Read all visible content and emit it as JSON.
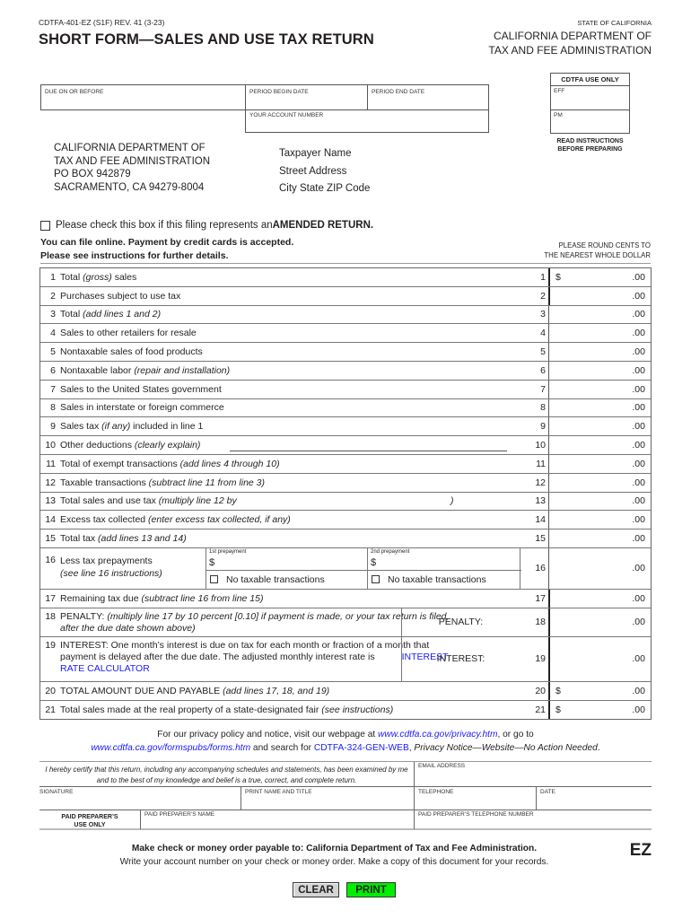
{
  "header": {
    "form_id": "CDTFA-401-EZ (S1F) REV. 41 (3-23)",
    "title": "SHORT FORM—SALES AND USE TAX RETURN",
    "state": "STATE OF CALIFORNIA",
    "agency_line1": "CALIFORNIA DEPARTMENT OF",
    "agency_line2": "TAX AND FEE ADMINISTRATION"
  },
  "fields": {
    "due_on_or_before": "DUE ON OR BEFORE",
    "period_begin": "PERIOD BEGIN DATE",
    "period_end": "PERIOD END DATE",
    "account_number": "YOUR ACCOUNT NUMBER"
  },
  "use_only": {
    "title": "CDTFA USE ONLY",
    "eff": "EFF",
    "pm": "PM",
    "read_line1": "READ INSTRUCTIONS",
    "read_line2": "BEFORE PREPARING"
  },
  "mailing": [
    "CALIFORNIA DEPARTMENT OF",
    "TAX AND FEE ADMINISTRATION",
    "PO BOX 942879",
    "SACRAMENTO, CA 94279-8004"
  ],
  "taxpayer": [
    "Taxpayer Name",
    "Street Address",
    "City State ZIP Code"
  ],
  "amended": {
    "prefix": "Please check this box if this filing represents an ",
    "bold": "AMENDED RETURN",
    "suffix": ".",
    "checked": false
  },
  "online_note": [
    "You can file online. Payment by credit cards is accepted.",
    "Please see instructions for further details."
  ],
  "round_note": [
    "PLEASE ROUND CENTS TO",
    "THE NEAREST WHOLE DOLLAR"
  ],
  "lines": [
    {
      "n": "1",
      "text": "Total ",
      "em": "(gross)",
      "after": " sales",
      "dollar": "$",
      "amount": ".00"
    },
    {
      "n": "2",
      "text": "Purchases subject to use tax",
      "em": "",
      "after": "",
      "dollar": "",
      "amount": ".00"
    },
    {
      "n": "3",
      "text": "Total ",
      "em": "(add lines 1 and 2)",
      "after": "",
      "dollar": "",
      "amount": ".00"
    },
    {
      "n": "4",
      "text": "Sales to other retailers for resale",
      "em": "",
      "after": "",
      "dollar": "",
      "amount": ".00"
    },
    {
      "n": "5",
      "text": "Nontaxable sales of food products",
      "em": "",
      "after": "",
      "dollar": "",
      "amount": ".00"
    },
    {
      "n": "6",
      "text": "Nontaxable labor ",
      "em": "(repair and installation)",
      "after": "",
      "dollar": "",
      "amount": ".00"
    },
    {
      "n": "7",
      "text": "Sales to the United States government",
      "em": "",
      "after": "",
      "dollar": "",
      "amount": ".00"
    },
    {
      "n": "8",
      "text": "Sales in interstate or foreign commerce",
      "em": "",
      "after": "",
      "dollar": "",
      "amount": ".00"
    },
    {
      "n": "9",
      "text": "Sales tax ",
      "em": "(if any)",
      "after": " included in line 1",
      "dollar": "",
      "amount": ".00"
    },
    {
      "n": "10",
      "text": "Other deductions ",
      "em": "(clearly explain)",
      "after": "",
      "dollar": "",
      "amount": ".00"
    },
    {
      "n": "11",
      "text": "Total of exempt transactions ",
      "em": "(add lines 4 through 10)",
      "after": "",
      "dollar": "",
      "amount": ".00"
    },
    {
      "n": "12",
      "text": "Taxable transactions ",
      "em": "(subtract line 11 from line 3)",
      "after": "",
      "dollar": "",
      "amount": ".00"
    },
    {
      "n": "13",
      "text": "Total sales and use tax ",
      "em": "(multiply line 12 by",
      "after": "",
      "dollar": "",
      "amount": ".00",
      "close": ")"
    },
    {
      "n": "14",
      "text": "Excess tax collected ",
      "em": "(enter excess tax collected, if any)",
      "after": "",
      "dollar": "",
      "amount": ".00"
    },
    {
      "n": "15",
      "text": "Total tax ",
      "em": "(add lines 13 and 14)",
      "after": "",
      "dollar": "",
      "amount": ".00"
    }
  ],
  "line16": {
    "n": "16",
    "text": "Less tax prepayments",
    "em": "(see line 16 instructions)",
    "pre1_label": "1st prepayment",
    "pre2_label": "2nd prepayment",
    "dollar": "$",
    "no_tx": "No taxable transactions",
    "amount": ".00"
  },
  "line17": {
    "n": "17",
    "text": "Remaining tax due ",
    "em": "(subtract line 16 from line 15)",
    "amount": ".00"
  },
  "line18": {
    "n": "18",
    "text": "PENALTY: ",
    "em": "(multiply line 17 by 10 percent [0.10] if payment is made, or your tax return is filed, after the due date shown above)",
    "side": "PENALTY:",
    "amount": ".00"
  },
  "line19": {
    "n": "19",
    "text": "INTEREST: One month’s interest is due on tax for each month or fraction of a month that payment is delayed after the due date. The adjusted monthly interest rate is",
    "link": "INTEREST RATE CALCULATOR",
    "side": "INTEREST:",
    "amount": ".00"
  },
  "line20": {
    "n": "20",
    "text": "TOTAL AMOUNT DUE AND PAYABLE ",
    "em": "(add lines 17, 18, and 19)",
    "dollar": "$",
    "amount": ".00"
  },
  "line21": {
    "n": "21",
    "text": "Total sales made at the real property of a state-designated fair ",
    "em": "(see instructions)",
    "dollar": "$",
    "amount": ".00"
  },
  "privacy": {
    "p1": "For our privacy policy and notice, visit our webpage at ",
    "link1": "www.cdtfa.ca.gov/privacy.htm",
    "p2": ", or go to",
    "link2": "www.cdtfa.ca.gov/formspubs/forms.htm",
    "p3": " and search for ",
    "link3": "CDTFA-324-GEN-WEB",
    "p4": ", ",
    "em": "Privacy Notice—Website—No Action Needed",
    "p5": "."
  },
  "certification": {
    "text": "I hereby certify that this return, including any accompanying schedules and statements, has been examined by me and to the best of my knowledge and belief is a true, correct, and complete return.",
    "email": "EMAIL ADDRESS",
    "signature": "SIGNATURE",
    "print_name": "PRINT NAME AND TITLE",
    "telephone": "TELEPHONE",
    "date": "DATE",
    "preparer_use_1": "PAID PREPARER’S",
    "preparer_use_2": "USE ONLY",
    "preparer_name": "PAID PREPARER’S NAME",
    "preparer_phone": "PAID PREPARER’S TELEPHONE NUMBER"
  },
  "footer": {
    "payable": "Make check or money order payable to: California Department of Tax and Fee Administration.",
    "note": "Write your account number on your check or money order. Make a copy of this document for your records.",
    "ez": "EZ",
    "clear": "CLEAR",
    "print": "PRINT"
  }
}
